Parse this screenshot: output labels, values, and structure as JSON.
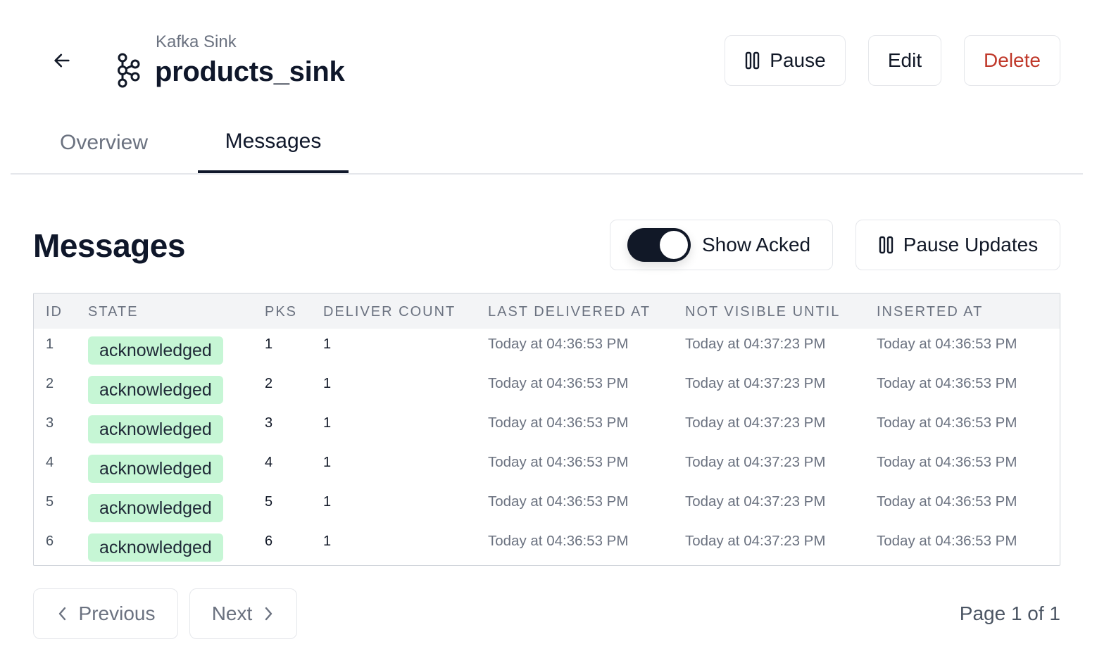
{
  "header": {
    "subtitle": "Kafka Sink",
    "title": "products_sink",
    "back_icon": "arrow-left-icon",
    "kind_icon": "kafka-icon"
  },
  "actions": {
    "pause_label": "Pause",
    "edit_label": "Edit",
    "delete_label": "Delete"
  },
  "tabs": [
    {
      "label": "Overview",
      "active": false
    },
    {
      "label": "Messages",
      "active": true
    }
  ],
  "section": {
    "title": "Messages",
    "show_acked_label": "Show Acked",
    "show_acked_on": true,
    "pause_updates_label": "Pause Updates"
  },
  "table": {
    "columns": [
      "ID",
      "STATE",
      "PKS",
      "DELIVER COUNT",
      "LAST DELIVERED AT",
      "NOT VISIBLE UNTIL",
      "INSERTED AT"
    ],
    "rows": [
      {
        "id": "1",
        "state": "acknowledged",
        "pks": "1",
        "deliver_count": "1",
        "last_delivered_at": "Today at 04:36:53 PM",
        "not_visible_until": "Today at 04:37:23 PM",
        "inserted_at": "Today at 04:36:53 PM"
      },
      {
        "id": "2",
        "state": "acknowledged",
        "pks": "2",
        "deliver_count": "1",
        "last_delivered_at": "Today at 04:36:53 PM",
        "not_visible_until": "Today at 04:37:23 PM",
        "inserted_at": "Today at 04:36:53 PM"
      },
      {
        "id": "3",
        "state": "acknowledged",
        "pks": "3",
        "deliver_count": "1",
        "last_delivered_at": "Today at 04:36:53 PM",
        "not_visible_until": "Today at 04:37:23 PM",
        "inserted_at": "Today at 04:36:53 PM"
      },
      {
        "id": "4",
        "state": "acknowledged",
        "pks": "4",
        "deliver_count": "1",
        "last_delivered_at": "Today at 04:36:53 PM",
        "not_visible_until": "Today at 04:37:23 PM",
        "inserted_at": "Today at 04:36:53 PM"
      },
      {
        "id": "5",
        "state": "acknowledged",
        "pks": "5",
        "deliver_count": "1",
        "last_delivered_at": "Today at 04:36:53 PM",
        "not_visible_until": "Today at 04:37:23 PM",
        "inserted_at": "Today at 04:36:53 PM"
      },
      {
        "id": "6",
        "state": "acknowledged",
        "pks": "6",
        "deliver_count": "1",
        "last_delivered_at": "Today at 04:36:53 PM",
        "not_visible_until": "Today at 04:37:23 PM",
        "inserted_at": "Today at 04:36:53 PM"
      }
    ]
  },
  "pagination": {
    "previous_label": "Previous",
    "next_label": "Next",
    "page_info": "Page 1 of 1"
  },
  "colors": {
    "primary": "#111827",
    "danger": "#c0392b",
    "badge_bg": "#c6f6d5",
    "muted_text": "#6b7280",
    "border": "#e5e7eb"
  }
}
